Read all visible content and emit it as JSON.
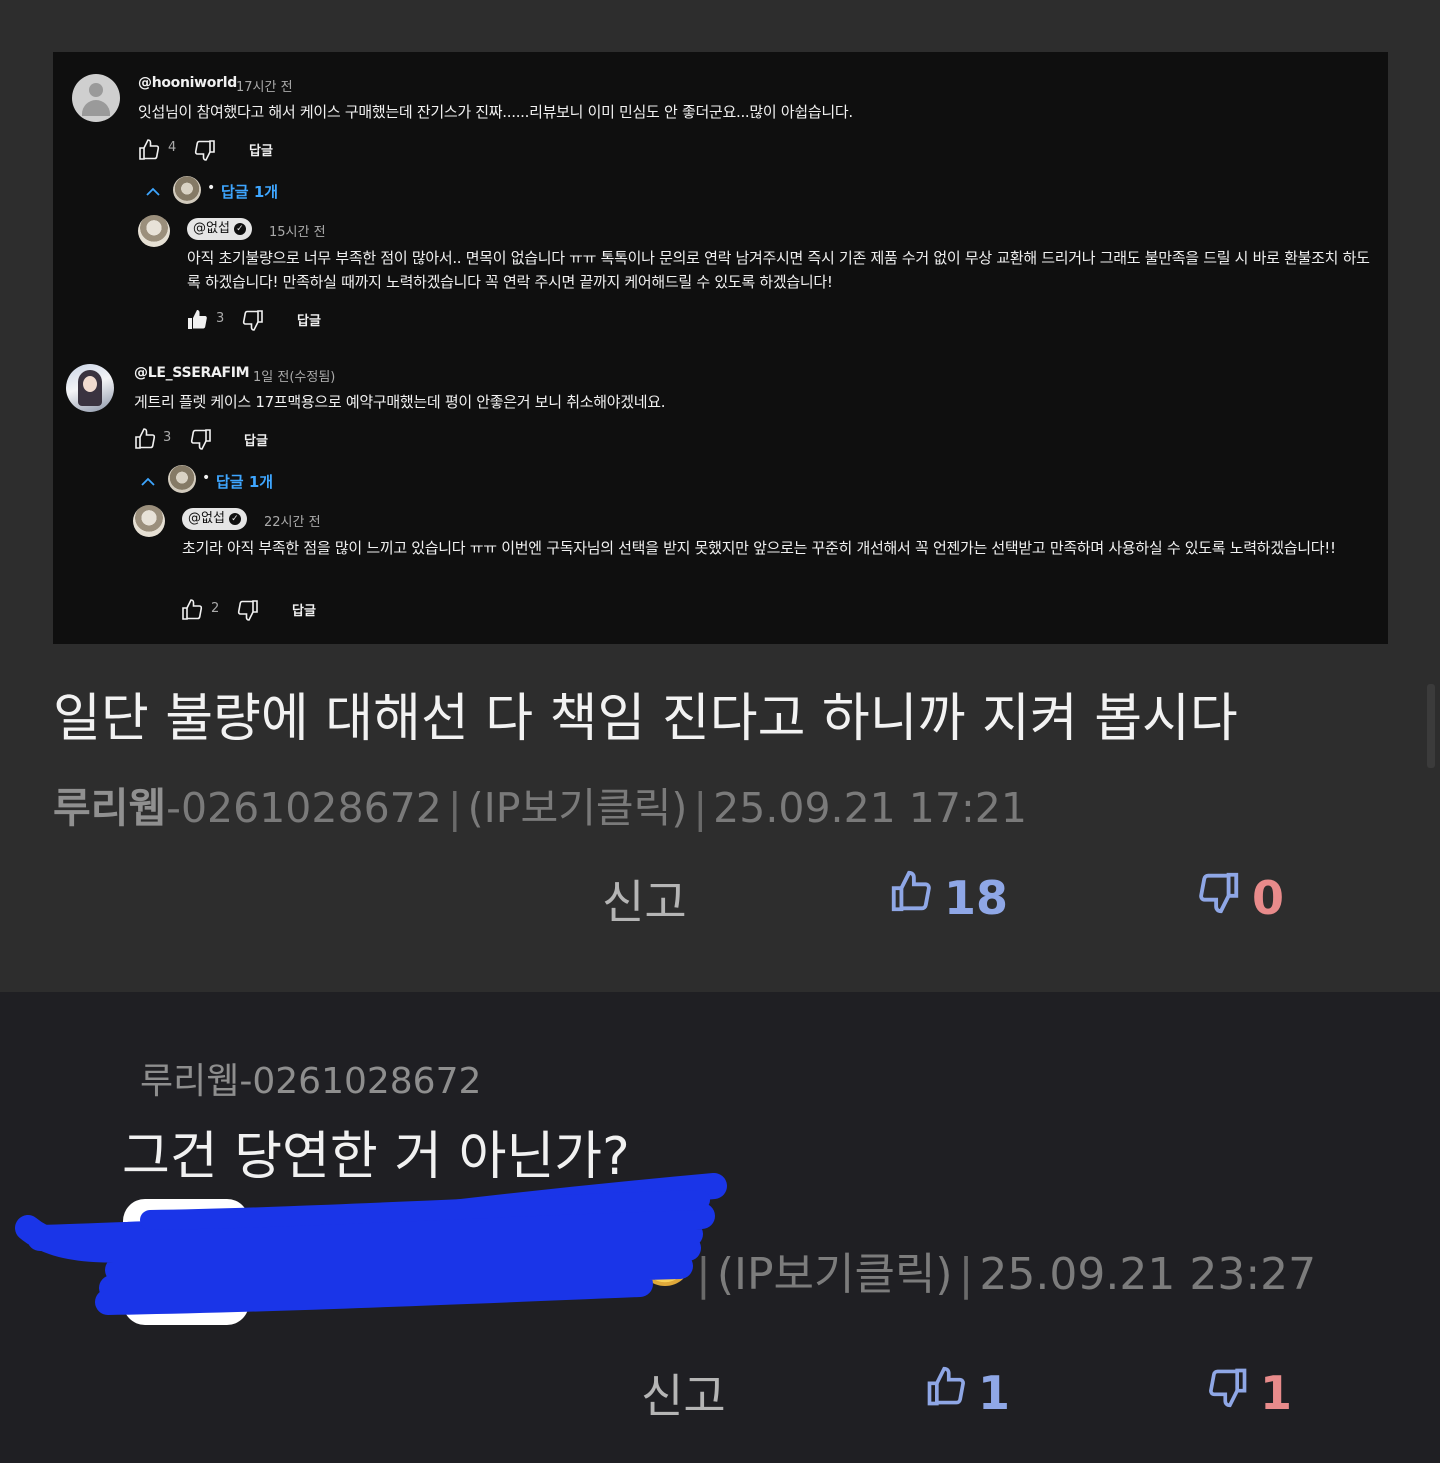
{
  "screenshot": {
    "comments": [
      {
        "handle": "@hooniworld",
        "time": "17시간 전",
        "text": "잇섭님이 참여했다고 해서 케이스 구매했는데 잔기스가 진짜......리뷰보니 이미 민심도 안 좋더군요...많이 아쉽습니다.",
        "likes": "4",
        "reply_label": "답글",
        "replies_link": "답글 1개",
        "reply": {
          "handle": "@없섭",
          "time": "15시간 전",
          "text": "아직 초기불량으로 너무 부족한 점이 많아서.. 면목이 없습니다 ㅠㅠ 톡톡이나 문의로 연락 남겨주시면 즉시 기존 제품 수거 없이 무상 교환해 드리거나 그래도 불만족을 드릴 시 바로 환불조치 하도록 하겠습니다! 만족하실 때까지 노력하겠습니다 꼭 연락 주시면 끝까지 케어해드릴 수 있도록 하겠습니다!",
          "likes": "3",
          "reply_label": "답글"
        }
      },
      {
        "handle": "@LE_SSERAFIM",
        "time": "1일 전(수정됨)",
        "text": "게트리 플렛 케이스 17프맥용으로 예약구매했는데 평이 안좋은거 보니 취소해야겠네요.",
        "likes": "3",
        "reply_label": "답글",
        "replies_link": "답글 1개",
        "reply": {
          "handle": "@없섭",
          "time": "22시간 전",
          "text": "초기라 아직 부족한 점을 많이 느끼고 있습니다 ㅠㅠ 이번엔 구독자님의 선택을 받지 못했지만 앞으로는 꾸준히 개선해서 꼭 언젠가는 선택받고 만족하며 사용하실 수 있도록 노력하겠습니다!!",
          "likes": "2",
          "reply_label": "답글"
        }
      }
    ]
  },
  "post": {
    "title": "일단 불량에 대해선 다 책임 진다고 하니까 지켜 봅시다",
    "author": "루리웹",
    "author_id": "-0261028672",
    "ip_link": "(IP보기클릭)",
    "datetime": "25.09.21 17:21",
    "report_label": "신고",
    "upvotes": "18",
    "downvotes": "0"
  },
  "comment": {
    "author": "루리웹-0261028672",
    "text": "그건 당연한 거 아닌가?",
    "ip_link": "(IP보기클릭)",
    "datetime": "25.09.21 23:27",
    "report_label": "신고",
    "upvotes": "1",
    "downvotes": "1"
  },
  "colors": {
    "background": "#2d2d2d",
    "comment_background": "#1f1f23",
    "upvote": "#8fa7e6",
    "downvote": "#e88b8b",
    "link_blue": "#3ea6ff",
    "redaction": "#1a35e8"
  },
  "icons": [
    "thumbs-up-icon",
    "thumbs-down-icon",
    "chevron-up-icon",
    "verified-check-icon",
    "avatar-icon"
  ]
}
